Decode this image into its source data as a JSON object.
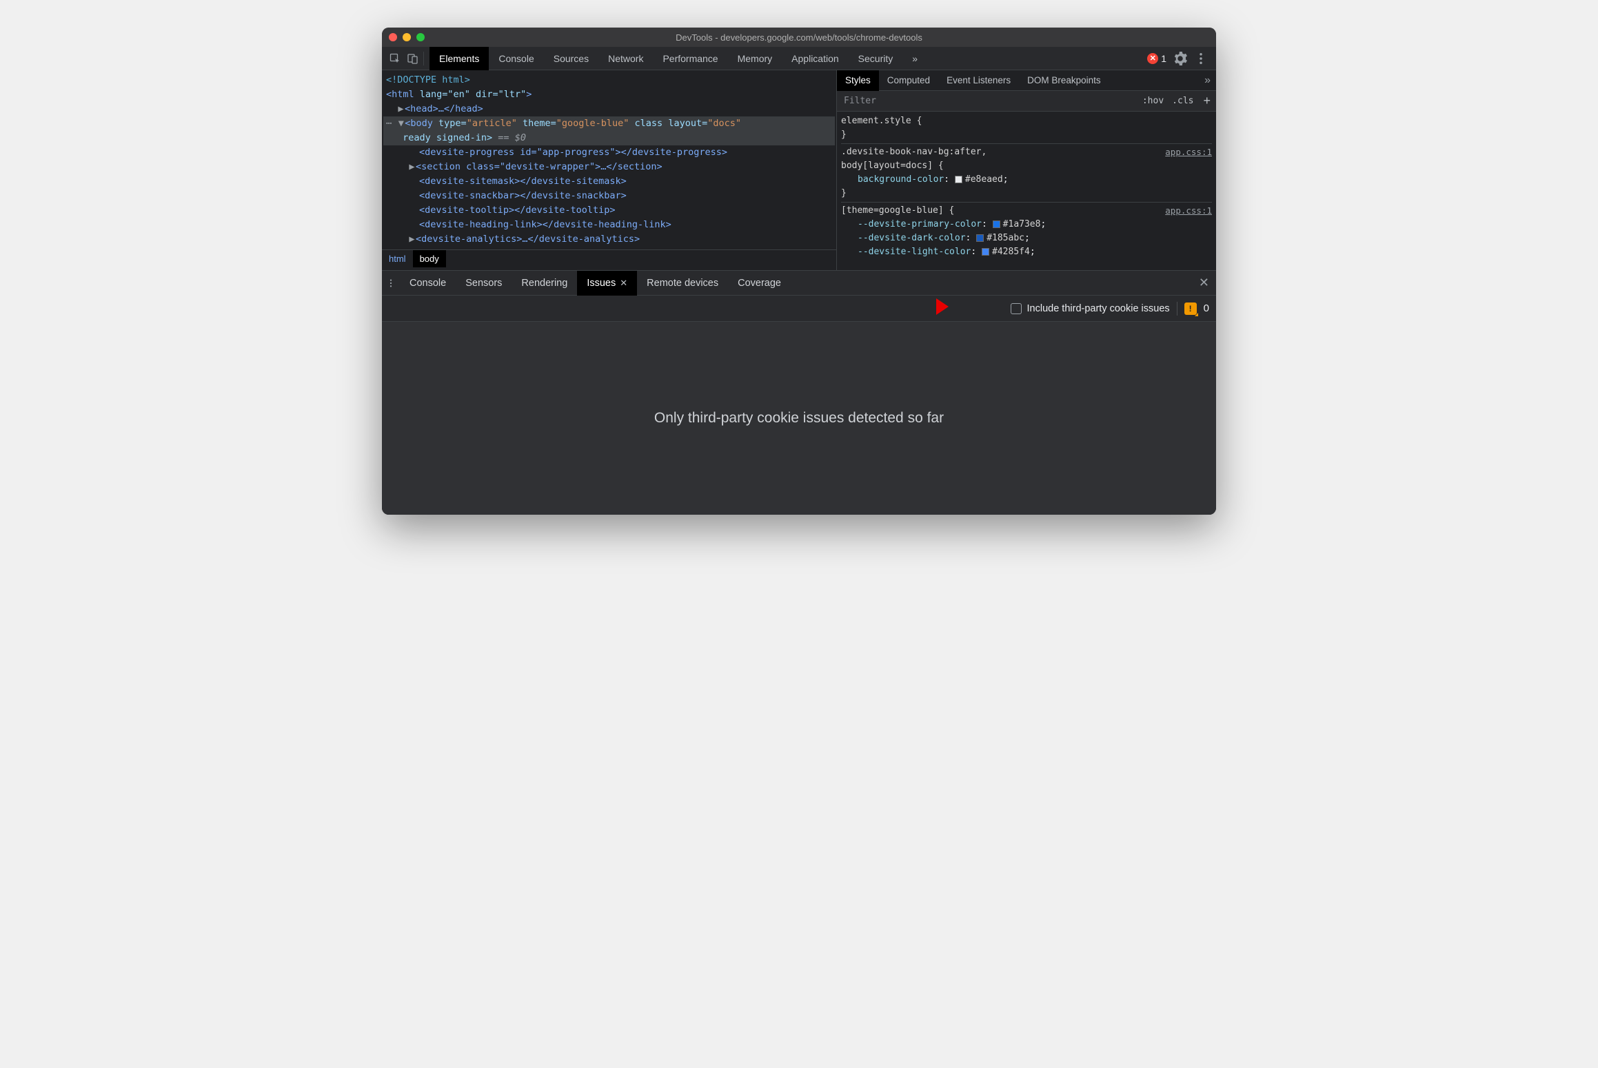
{
  "window": {
    "title": "DevTools - developers.google.com/web/tools/chrome-devtools"
  },
  "toolbar": {
    "tabs": [
      "Elements",
      "Console",
      "Sources",
      "Network",
      "Performance",
      "Memory",
      "Application",
      "Security"
    ],
    "active": "Elements",
    "more": "»",
    "error_count": "1"
  },
  "dom": {
    "line0": "<!DOCTYPE html>",
    "line1_open": "<html ",
    "line1_attrs": "lang=\"en\" dir=\"ltr\"",
    "line1_close": ">",
    "line2": "<head>…</head>",
    "body_pre": "<body ",
    "body_attr1": "type=",
    "body_val1": "\"article\"",
    "body_attr2": " theme=",
    "body_val2": "\"google-blue\"",
    "body_attr3": " class layout=",
    "body_val3": "\"docs\"",
    "body_line2": " ready signed-in>",
    "body_eq": " == ",
    "body_dollar": "$0",
    "c1": "<devsite-progress id=\"app-progress\"></devsite-progress>",
    "c2": "<section class=\"devsite-wrapper\">…</section>",
    "c3": "<devsite-sitemask></devsite-sitemask>",
    "c4": "<devsite-snackbar></devsite-snackbar>",
    "c5": "<devsite-tooltip></devsite-tooltip>",
    "c6": "<devsite-heading-link></devsite-heading-link>",
    "c7": "<devsite-analytics>…</devsite-analytics>"
  },
  "crumb": {
    "a": "html",
    "b": "body"
  },
  "styles": {
    "tabs": [
      "Styles",
      "Computed",
      "Event Listeners",
      "DOM Breakpoints"
    ],
    "more": "»",
    "filter_placeholder": "Filter",
    "hov": ":hov",
    "cls": ".cls",
    "rules": [
      {
        "selector_lines": [
          "element.style {",
          "}"
        ]
      },
      {
        "src": "app.css:1",
        "selector_lines": [
          ".devsite-book-nav-bg:after,",
          "body[layout=docs] {"
        ],
        "props": [
          {
            "name": "background-color",
            "value": "#e8eaed",
            "swatch": "#e8eaed"
          }
        ],
        "close": "}"
      },
      {
        "src": "app.css:1",
        "selector_lines": [
          "[theme=google-blue] {"
        ],
        "props": [
          {
            "name": "--devsite-primary-color",
            "value": "#1a73e8",
            "swatch": "#1a73e8"
          },
          {
            "name": "--devsite-dark-color",
            "value": "#185abc",
            "swatch": "#185abc"
          },
          {
            "name": "--devsite-light-color",
            "value": "#4285f4",
            "swatch": "#4285f4"
          }
        ]
      }
    ]
  },
  "drawer": {
    "tabs": [
      "Console",
      "Sensors",
      "Rendering",
      "Issues",
      "Remote devices",
      "Coverage"
    ],
    "active": "Issues",
    "checkbox_label": "Include third-party cookie issues",
    "count": "0",
    "body_text": "Only third-party cookie issues detected so far"
  }
}
